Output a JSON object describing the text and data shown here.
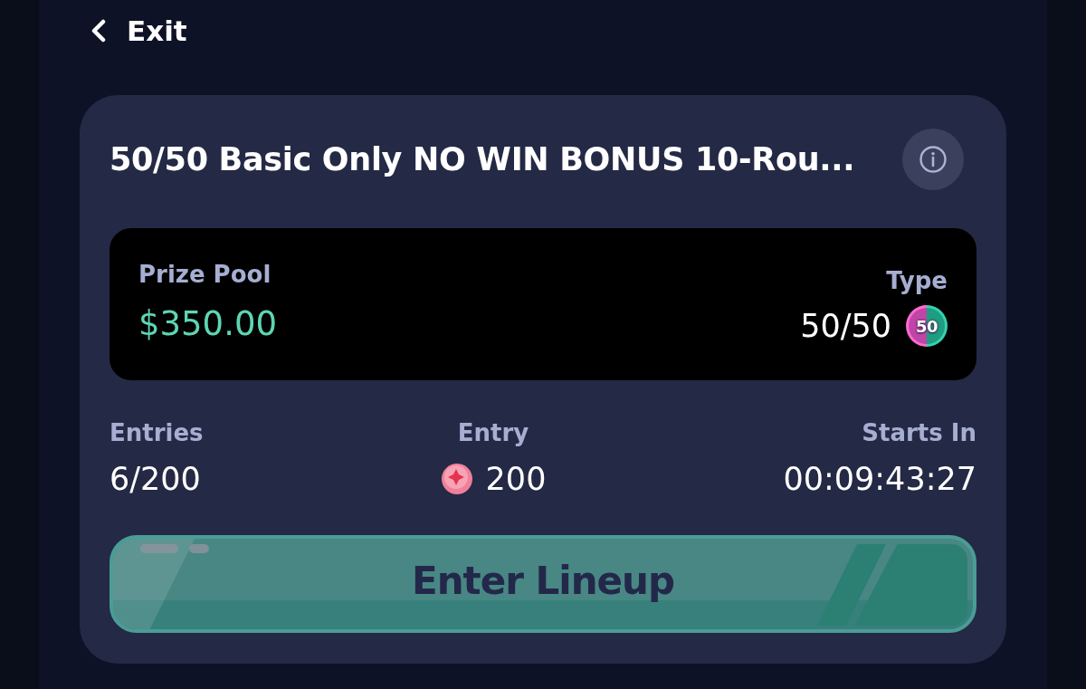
{
  "header": {
    "back_label": "Exit"
  },
  "contest": {
    "title": "50/50 Basic Only NO WIN BONUS 10-Rou...",
    "prize_pool": {
      "label": "Prize Pool",
      "value": "$350.00"
    },
    "type": {
      "label": "Type",
      "value": "50/50",
      "badge": "50"
    },
    "stats": [
      {
        "kind": "plain",
        "label": "Entries",
        "value": "6/200"
      },
      {
        "kind": "coin",
        "label": "Entry",
        "value": "200"
      },
      {
        "kind": "plain",
        "label": "Starts In",
        "value": "00:09:43:27"
      }
    ],
    "action": {
      "label": "Enter Lineup"
    }
  }
}
